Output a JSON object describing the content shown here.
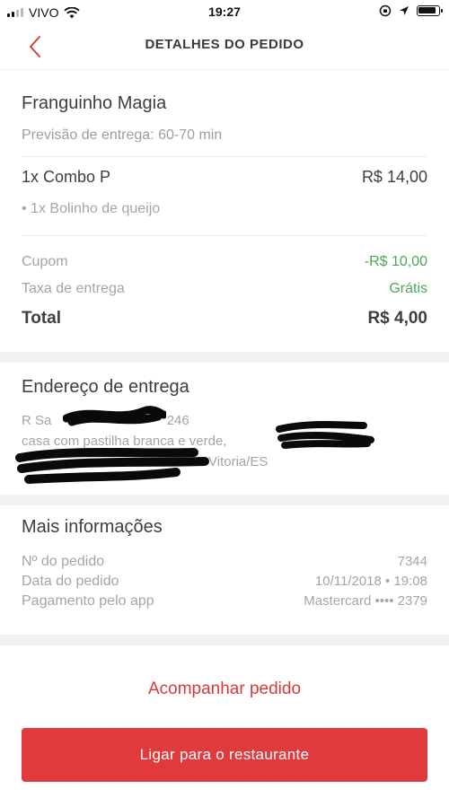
{
  "status_bar": {
    "carrier": "VIVO",
    "time": "19:27"
  },
  "header": {
    "title": "DETALHES DO PEDIDO",
    "back_icon": "chevron-left-icon"
  },
  "order": {
    "restaurant_name": "Franguinho Magia",
    "delivery_estimate": "Previsão de entrega: 60-70 min",
    "items": [
      {
        "name": "1x Combo P",
        "price": "R$ 14,00",
        "extras": [
          "• 1x Bolinho de queijo"
        ]
      }
    ],
    "coupon_label": "Cupom",
    "coupon_value": "-R$ 10,00",
    "delivery_fee_label": "Taxa de entrega",
    "delivery_fee_value": "Grátis",
    "total_label": "Total",
    "total_value": "R$ 4,00"
  },
  "address": {
    "title": "Endereço de entrega",
    "line1_prefix": "R Sa",
    "line1_suffix": "246",
    "line2": "casa com pastilha branca e verde,",
    "line3_suffix": "Vitoria/ES"
  },
  "more_info": {
    "title": "Mais informações",
    "rows": [
      {
        "label": "Nº do pedido",
        "value": "7344"
      },
      {
        "label": "Data do pedido",
        "value": "10/11/2018 • 19:08"
      },
      {
        "label": "Pagamento pelo app",
        "value": "Mastercard •••• 2379"
      }
    ]
  },
  "actions": {
    "track_label": "Acompanhar pedido",
    "call_label": "Ligar para o restaurante"
  },
  "colors": {
    "accent_red": "#e13a3d",
    "link_red": "#d9383a",
    "green": "#4fa65a",
    "muted_text": "#a5a5a5"
  }
}
